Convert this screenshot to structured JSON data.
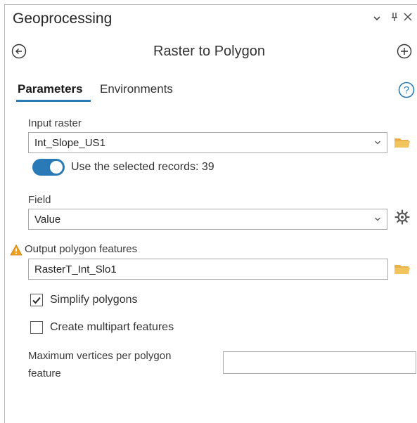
{
  "pane": {
    "title": "Geoprocessing",
    "controls": {
      "menu": "⌄",
      "pin": "⊥",
      "close": "✕"
    }
  },
  "tool": {
    "name": "Raster to Polygon"
  },
  "tabs": [
    {
      "label": "Parameters",
      "active": true
    },
    {
      "label": "Environments",
      "active": false
    }
  ],
  "params": {
    "input_raster": {
      "label": "Input raster",
      "value": "Int_Slope_US1"
    },
    "use_selected": {
      "label": "Use the selected records: 39",
      "on": true
    },
    "field": {
      "label": "Field",
      "value": "Value"
    },
    "output": {
      "label": "Output polygon features",
      "value": "RasterT_Int_Slo1"
    },
    "simplify": {
      "label": "Simplify polygons",
      "checked": true
    },
    "multipart": {
      "label": "Create multipart features",
      "checked": false
    },
    "max_vertices": {
      "label_line1": "Maximum vertices per polygon",
      "label_line2": "feature",
      "value": ""
    }
  },
  "colors": {
    "accent": "#2a7ab8",
    "folder": "#e8b04a",
    "warning": "#f0a020"
  },
  "icons": [
    "back-icon",
    "add-icon",
    "help-icon",
    "folder-icon",
    "gear-icon",
    "warning-icon",
    "chevron-down-icon"
  ]
}
